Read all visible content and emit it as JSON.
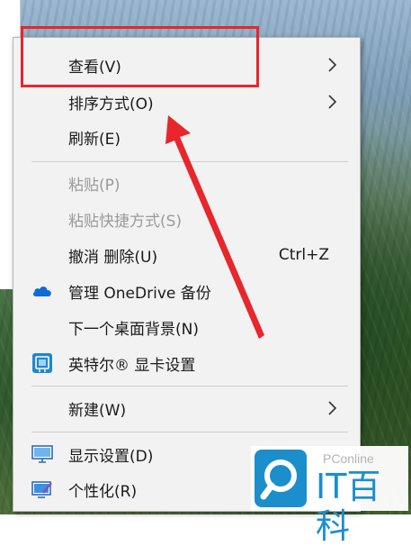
{
  "context_menu": {
    "items": [
      {
        "label": "查看(V)",
        "submenu": true,
        "disabled": false
      },
      {
        "label": "排序方式(O)",
        "submenu": true,
        "disabled": false
      },
      {
        "label": "刷新(E)",
        "submenu": false,
        "disabled": false
      },
      {
        "label": "粘贴(P)",
        "submenu": false,
        "disabled": true
      },
      {
        "label": "粘贴快捷方式(S)",
        "submenu": false,
        "disabled": true
      },
      {
        "label": "撤消 删除(U)",
        "shortcut": "Ctrl+Z",
        "submenu": false,
        "disabled": false
      },
      {
        "label": "管理 OneDrive 备份",
        "icon": "onedrive-cloud-icon",
        "submenu": false,
        "disabled": false
      },
      {
        "label": "下一个桌面背景(N)",
        "submenu": false,
        "disabled": false
      },
      {
        "label": "英特尔® 显卡设置",
        "icon": "intel-graphics-icon",
        "submenu": false,
        "disabled": false
      },
      {
        "label": "新建(W)",
        "submenu": true,
        "disabled": false
      },
      {
        "label": "显示设置(D)",
        "icon": "display-settings-icon",
        "submenu": false,
        "disabled": false
      },
      {
        "label": "个性化(R)",
        "icon": "personalize-icon",
        "submenu": false,
        "disabled": false
      }
    ]
  },
  "annotation": {
    "highlight_color": "#e8262b",
    "arrow_color": "#e8262b"
  },
  "watermark": {
    "small_text": "PConline",
    "brand_text": "IT百科",
    "brand_color": "#1c8ecb"
  },
  "colors": {
    "menu_bg": "#f2f2f2",
    "text": "#1a1a1a",
    "disabled_text": "#9a9a9a",
    "onedrive": "#0f6cd6"
  }
}
